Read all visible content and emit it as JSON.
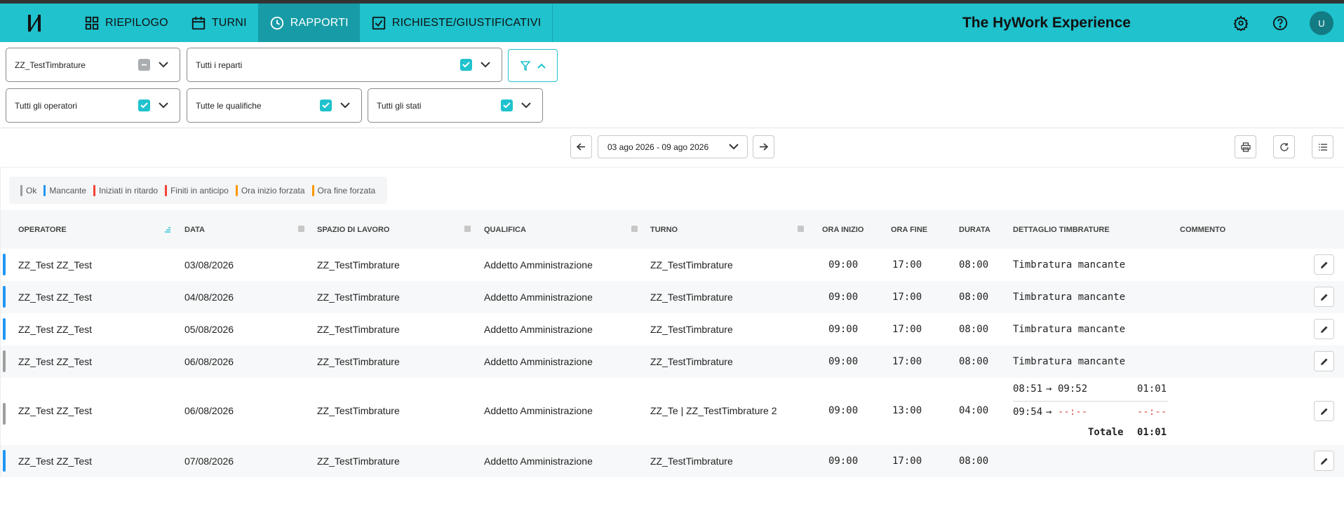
{
  "app": {
    "logo": "Һ",
    "brand": "The HyWork Experience",
    "avatar": "U"
  },
  "nav": {
    "tabs": [
      {
        "label": "RIEPILOGO",
        "icon": "dashboard-icon"
      },
      {
        "label": "TURNI",
        "icon": "calendar-icon"
      },
      {
        "label": "RAPPORTI",
        "icon": "clock-icon",
        "active": true
      },
      {
        "label": "RICHIESTE/GIUSTIFICATIVI",
        "icon": "checkbox-icon"
      }
    ]
  },
  "filters": {
    "site": "ZZ_TestTimbrature",
    "departments": "Tutti i reparti",
    "operators": "Tutti gli operatori",
    "qualifications": "Tutte le qualifiche",
    "states": "Tutti gli stati"
  },
  "toolbar": {
    "date_range": "03 ago 2026 - 09 ago 2026"
  },
  "legend": [
    {
      "label": "Ok",
      "color": "#9e9e9e"
    },
    {
      "label": "Mancante",
      "color": "#2196f3"
    },
    {
      "label": "Iniziati in ritardo",
      "color": "#f44336"
    },
    {
      "label": "Finiti in anticipo",
      "color": "#f44336"
    },
    {
      "label": "Ora inizio forzata",
      "color": "#ff9800"
    },
    {
      "label": "Ora fine forzata",
      "color": "#ff9800"
    }
  ],
  "table": {
    "headers": {
      "operator": "OPERATORE",
      "date": "DATA",
      "workspace": "SPAZIO DI LAVORO",
      "qualification": "QUALIFICA",
      "shift": "TURNO",
      "start": "ORA INIZIO",
      "end": "ORA FINE",
      "duration": "DURATA",
      "detail": "DETTAGLIO TIMBRATURE",
      "comment": "COMMENTO"
    },
    "rows": [
      {
        "operator": "ZZ_Test ZZ_Test",
        "date": "03/08/2026",
        "workspace": "ZZ_TestTimbrature",
        "qualification": "Addetto Amministrazione",
        "shift": "ZZ_TestTimbrature",
        "start": "09:00",
        "end": "17:00",
        "duration": "08:00",
        "detail": "Timbratura mancante",
        "status_color": "#2196f3"
      },
      {
        "operator": "ZZ_Test ZZ_Test",
        "date": "04/08/2026",
        "workspace": "ZZ_TestTimbrature",
        "qualification": "Addetto Amministrazione",
        "shift": "ZZ_TestTimbrature",
        "start": "09:00",
        "end": "17:00",
        "duration": "08:00",
        "detail": "Timbratura mancante",
        "status_color": "#2196f3"
      },
      {
        "operator": "ZZ_Test ZZ_Test",
        "date": "05/08/2026",
        "workspace": "ZZ_TestTimbrature",
        "qualification": "Addetto Amministrazione",
        "shift": "ZZ_TestTimbrature",
        "start": "09:00",
        "end": "17:00",
        "duration": "08:00",
        "detail": "Timbratura mancante",
        "status_color": "#2196f3"
      },
      {
        "operator": "ZZ_Test ZZ_Test",
        "date": "06/08/2026",
        "workspace": "ZZ_TestTimbrature",
        "qualification": "Addetto Amministrazione",
        "shift": "ZZ_TestTimbrature",
        "start": "09:00",
        "end": "17:00",
        "duration": "08:00",
        "detail": "Timbratura mancante",
        "status_color": "#9e9e9e"
      },
      {
        "operator": "ZZ_Test ZZ_Test",
        "date": "06/08/2026",
        "workspace": "ZZ_TestTimbrature",
        "qualification": "Addetto Amministrazione",
        "shift": "ZZ_Te | ZZ_TestTimbrature 2",
        "start": "09:00",
        "end": "13:00",
        "duration": "04:00",
        "status_color": "#9e9e9e",
        "punches": [
          {
            "in": "08:51",
            "arrow": "→",
            "out": "09:52",
            "total": "01:01"
          },
          {
            "in": "09:54",
            "arrow": "→",
            "out": "--:--",
            "total": "--:--"
          }
        ],
        "total_label": "Totale",
        "total_value": "01:01"
      },
      {
        "operator": "ZZ_Test ZZ_Test",
        "date": "07/08/2026",
        "workspace": "ZZ_TestTimbrature",
        "qualification": "Addetto Amministrazione",
        "shift": "ZZ_TestTimbrature",
        "start": "09:00",
        "end": "17:00",
        "duration": "08:00",
        "detail": "",
        "status_color": "#2196f3"
      }
    ]
  }
}
